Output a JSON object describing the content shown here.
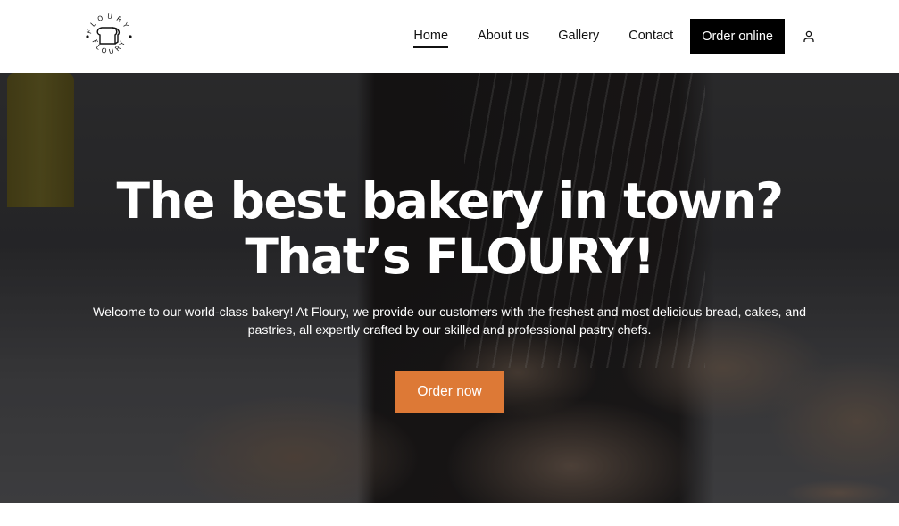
{
  "brand": {
    "name": "FLOURY",
    "logo_icon": "bread-loaf-icon"
  },
  "nav": {
    "items": [
      {
        "label": "Home",
        "active": true
      },
      {
        "label": "About us",
        "active": false
      },
      {
        "label": "Gallery",
        "active": false
      },
      {
        "label": "Contact",
        "active": false
      }
    ],
    "cta_label": "Order online",
    "account_icon": "user-icon"
  },
  "hero": {
    "title_line1": "The best bakery in town?",
    "title_line2": "That’s FLOURY!",
    "description": "Welcome to our world-class bakery! At Floury, we provide our customers with the freshest and most delicious bread, cakes, and pastries, all expertly crafted by our skilled and professional pastry chefs.",
    "cta_label": "Order now"
  },
  "colors": {
    "accent": "#dd7936",
    "nav_cta_bg": "#000000",
    "header_bg": "#ffffff"
  }
}
